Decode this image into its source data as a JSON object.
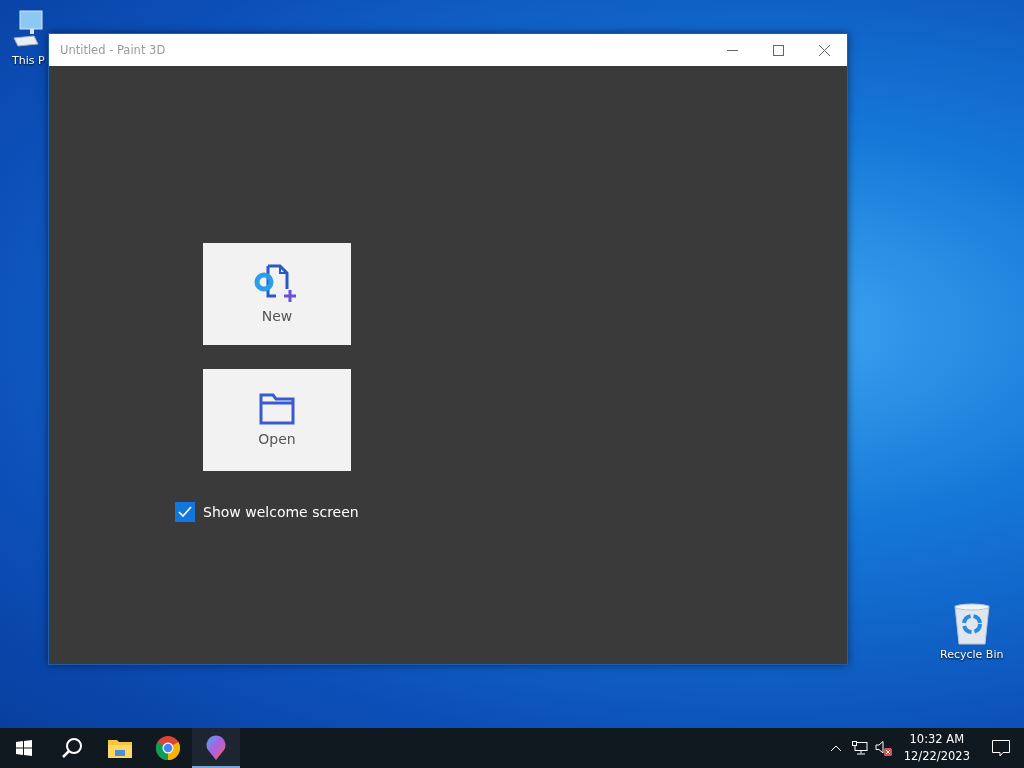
{
  "desktop_icons": [
    {
      "kind": "computer",
      "label": "This P"
    },
    {
      "kind": "recycle",
      "label": "Recycle Bin"
    }
  ],
  "window": {
    "title": "Untitled - Paint 3D",
    "tiles": [
      {
        "kind": "new",
        "label": "New"
      },
      {
        "kind": "open",
        "label": "Open"
      }
    ],
    "welcome_checkbox": {
      "label": "Show welcome screen",
      "checked": true
    }
  },
  "taskbar": {
    "apps": [
      {
        "kind": "start",
        "running": false
      },
      {
        "kind": "search",
        "running": false
      },
      {
        "kind": "explorer",
        "running": false
      },
      {
        "kind": "chrome",
        "running": false
      },
      {
        "kind": "paint3d",
        "running": true
      }
    ],
    "time": "10:32 AM",
    "date": "12/22/2023"
  }
}
